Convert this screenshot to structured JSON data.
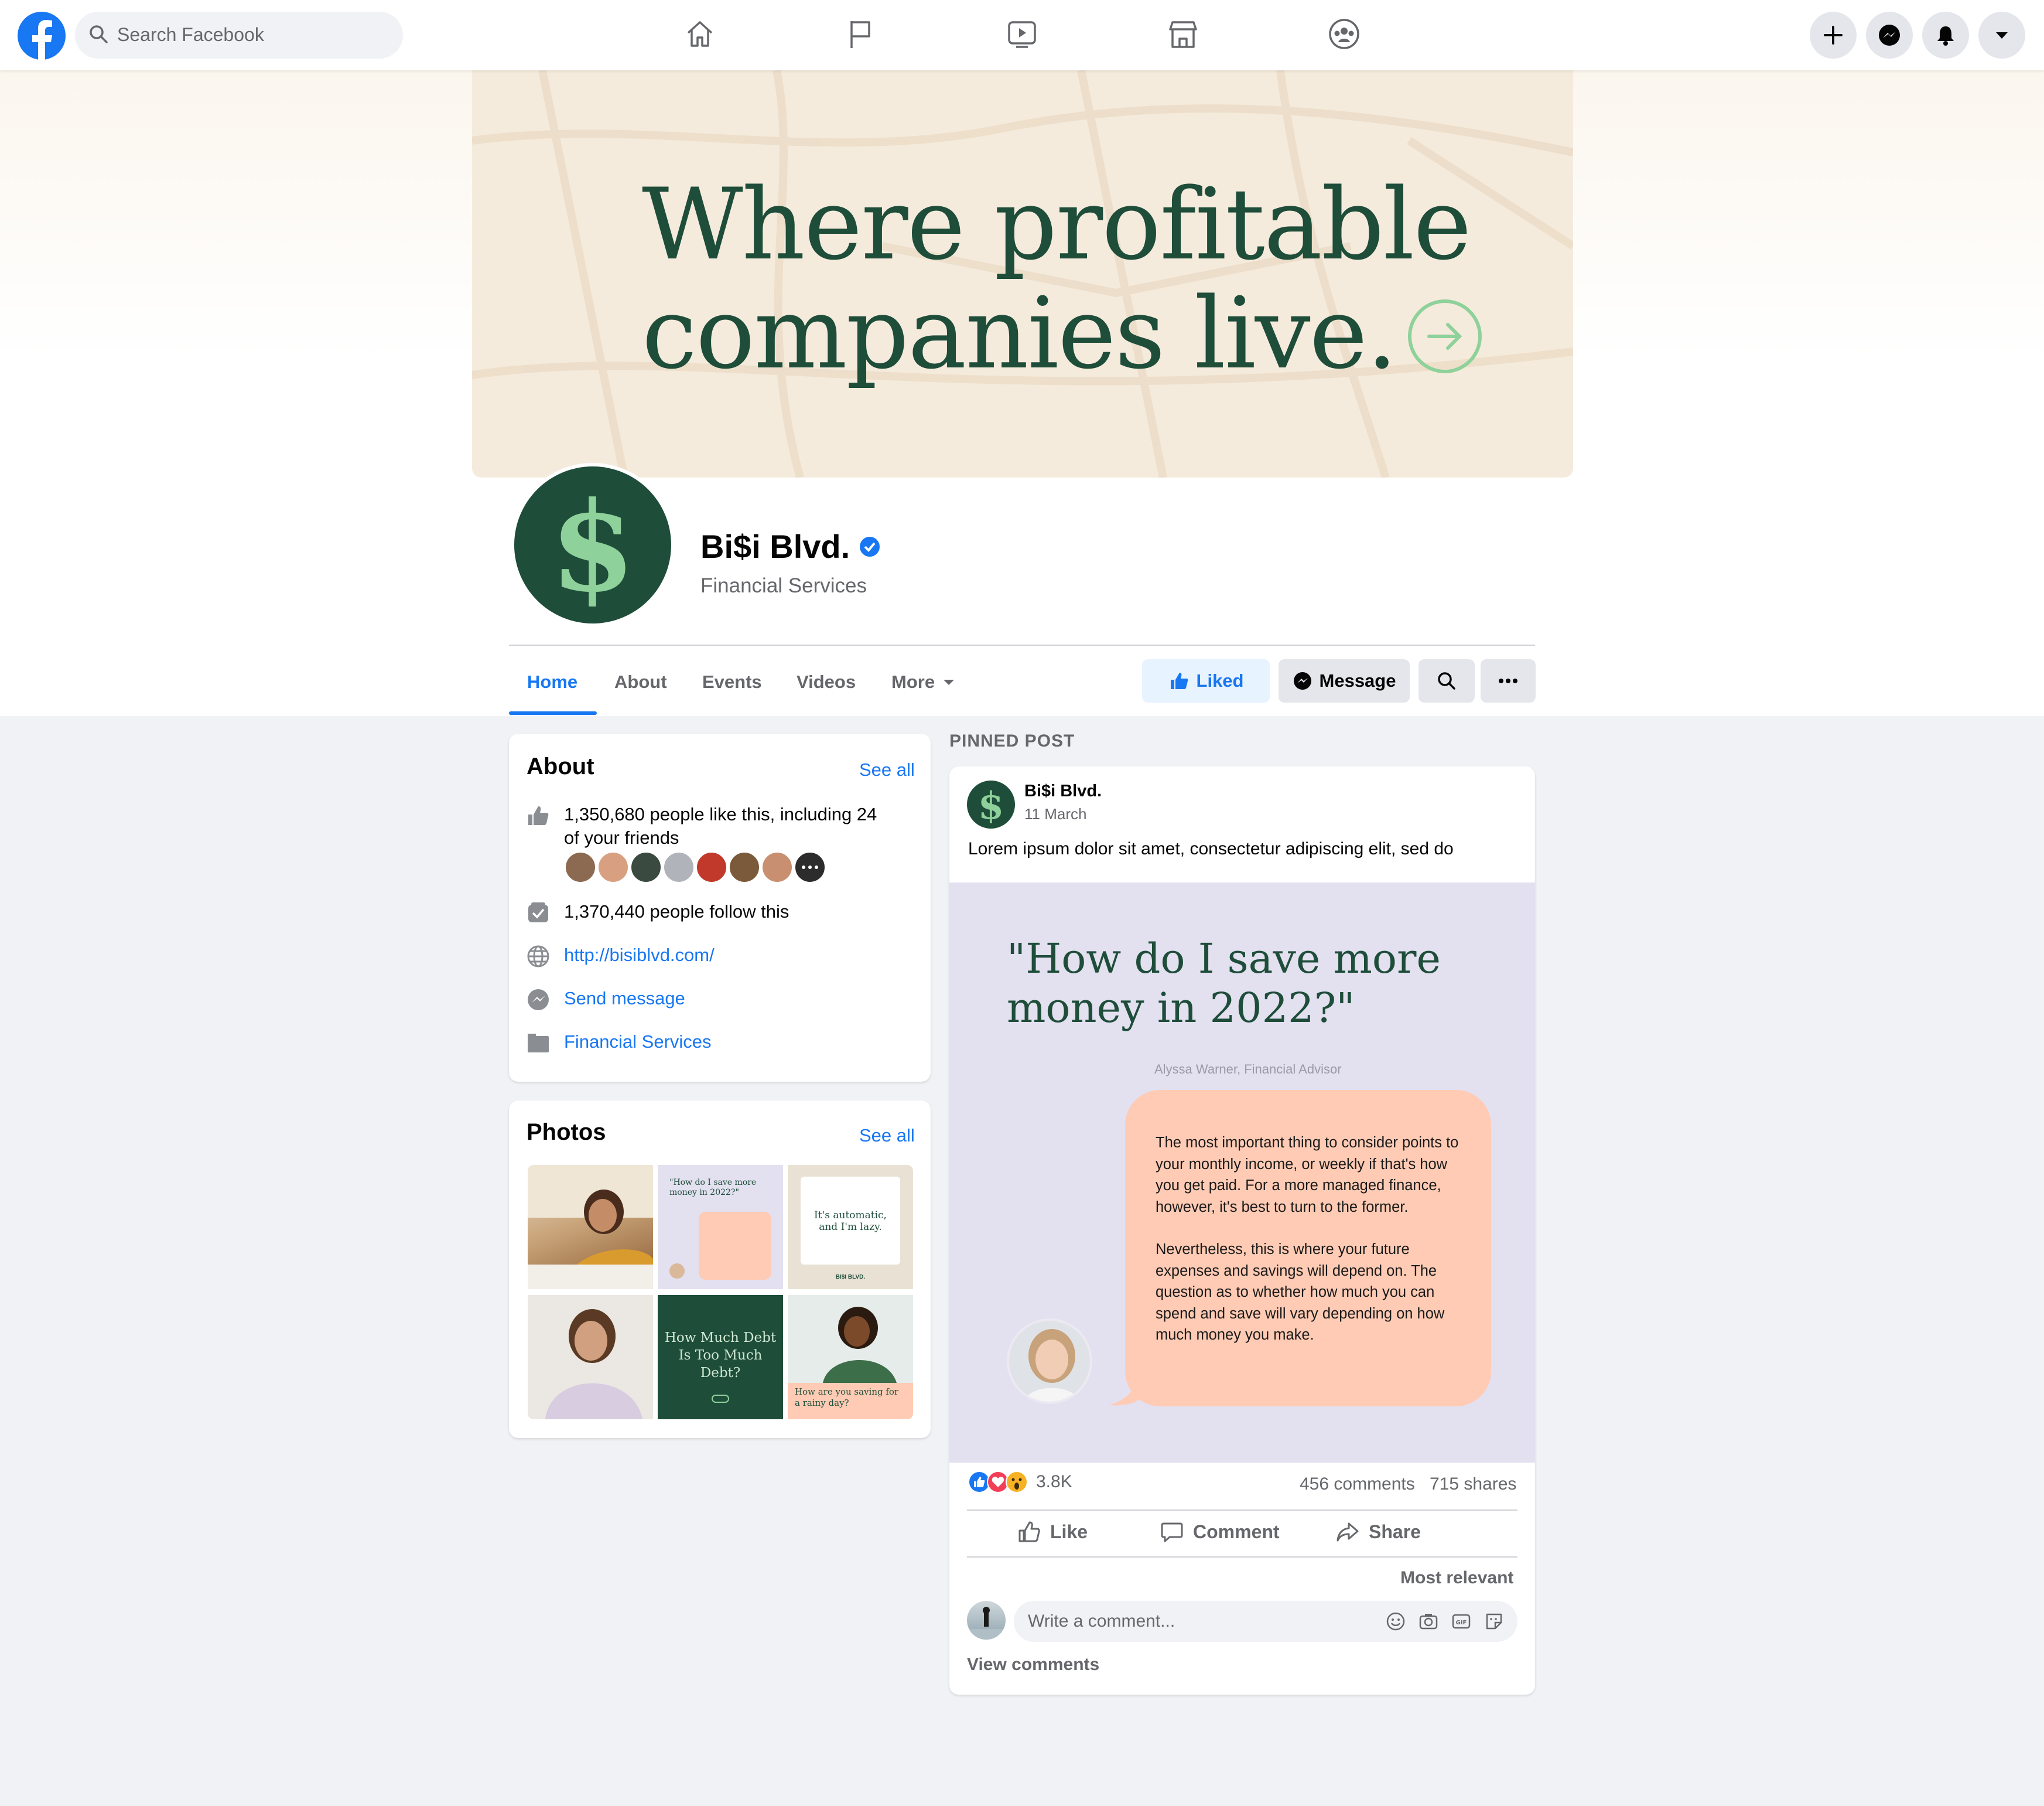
{
  "topbar": {
    "search_placeholder": "Search Facebook",
    "nav_icons": [
      "home-icon",
      "pages-flag-icon",
      "watch-icon",
      "marketplace-icon",
      "groups-icon"
    ],
    "right_icons": [
      "plus-icon",
      "messenger-icon",
      "bell-icon",
      "caret-down-icon"
    ]
  },
  "cover": {
    "line1": "Where profitable",
    "line2": "companies live."
  },
  "page": {
    "name": "Bi$i Blvd.",
    "category": "Financial Services",
    "verified": true
  },
  "tabs": [
    "Home",
    "About",
    "Events",
    "Videos",
    "More"
  ],
  "actions": {
    "liked": "Liked",
    "message": "Message"
  },
  "about": {
    "title": "About",
    "see_all": "See all",
    "likes_line1": "1,350,680 people like this, including 24",
    "likes_line2": "of your friends",
    "follows": "1,370,440 people follow this",
    "website": "http://bisiblvd.com/",
    "send_message": "Send message",
    "category": "Financial Services"
  },
  "photos": {
    "title": "Photos",
    "see_all": "See all",
    "thumb_texts": {
      "p2_title": "\"How do I save more money in 2022?\"",
      "p3_title": "It's automatic, and I'm lazy.",
      "p3_brand": "BI$I BLVD.",
      "p5_title": "How Much Debt Is Too Much Debt?",
      "p6_title": "How are you saving for a rainy day?"
    }
  },
  "post": {
    "pinned_label": "PINNED POST",
    "author": "Bi$i Blvd.",
    "date": "11 March",
    "text": "Lorem ipsum dolor sit amet, consectetur adipiscing elit, sed do",
    "image": {
      "quote_line1": "\"How do I save more",
      "quote_line2": "money in 2022?\"",
      "attribution": "Alyssa Warner, Financial Advisor",
      "para1": "The most important thing to consider points to your monthly income, or weekly if that's how you get paid. For a more managed finance, however, it's best to turn to the former.",
      "para2": "Nevertheless, this is where your future expenses and savings will depend on. The question as to whether how much you can spend and save will vary depending on how much money you make."
    },
    "reactions_count": "3.8K",
    "comments": "456 comments",
    "shares": "715 shares",
    "like": "Like",
    "comment": "Comment",
    "share": "Share",
    "sort": "Most relevant",
    "comment_placeholder": "Write a comment...",
    "view_comments": "View comments"
  },
  "colors": {
    "brand_blue": "#1877f2",
    "brand_green": "#1e4d3a",
    "cover_bg": "#f5ebdc",
    "bubble": "#ffcbb4",
    "post_image_bg": "#e3e0f0"
  }
}
